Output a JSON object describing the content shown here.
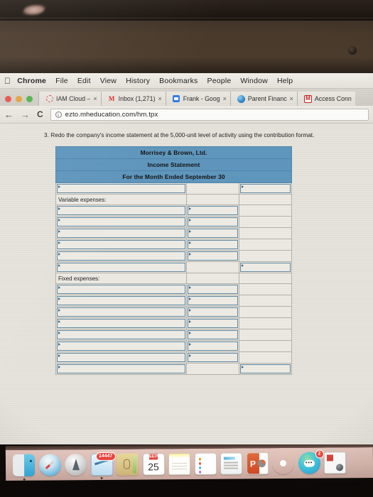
{
  "os_menubar": {
    "apple_icon": "apple-logo-icon",
    "items": [
      {
        "label": "Chrome",
        "bold": true
      },
      {
        "label": "File",
        "bold": false
      },
      {
        "label": "Edit",
        "bold": false
      },
      {
        "label": "View",
        "bold": false
      },
      {
        "label": "History",
        "bold": false
      },
      {
        "label": "Bookmarks",
        "bold": false
      },
      {
        "label": "People",
        "bold": false
      },
      {
        "label": "Window",
        "bold": false
      },
      {
        "label": "Help",
        "bold": false
      }
    ]
  },
  "browser": {
    "window_controls": [
      "close",
      "minimize",
      "maximize"
    ],
    "tabs": [
      {
        "label": "IAM Cloud –",
        "favicon": "dashed-circle-icon",
        "close": "×"
      },
      {
        "label": "Inbox (1,271)",
        "favicon": "gmail-m-icon",
        "close": "×"
      },
      {
        "label": "Frank - Goog",
        "favicon": "blue-square-icon",
        "close": "×"
      },
      {
        "label": "Parent Financ",
        "favicon": "globe-icon",
        "close": "×"
      },
      {
        "label": "Access Conn",
        "favicon": "mcgraw-hill-m-icon",
        "close": "×"
      }
    ],
    "nav": {
      "back": "←",
      "forward": "→",
      "reload": "C"
    },
    "omnibox": {
      "info_glyph": "i",
      "url": "ezto.mheducation.com/hm.tpx"
    }
  },
  "page": {
    "question": "3. Redo the company's income statement at the 5,000-unit level of activity using the contribution format.",
    "worksheet": {
      "header_color": "#5f96bd",
      "title_rows": [
        "Morrisey & Brown, Ltd.",
        "Income Statement",
        "For the Month Ended September 30"
      ],
      "columns": 3,
      "rows": [
        {
          "type": "input-row",
          "label": "",
          "cells": [
            "input",
            "blank",
            "input"
          ]
        },
        {
          "type": "label-row",
          "label": "Variable expenses:",
          "cells": [
            "label",
            "blank",
            "blank"
          ]
        },
        {
          "type": "input-row",
          "label": "",
          "cells": [
            "input",
            "input",
            "blank"
          ]
        },
        {
          "type": "input-row",
          "label": "",
          "cells": [
            "input",
            "input",
            "blank"
          ]
        },
        {
          "type": "input-row",
          "label": "",
          "cells": [
            "input",
            "input",
            "blank"
          ]
        },
        {
          "type": "input-row",
          "label": "",
          "cells": [
            "input",
            "input",
            "blank"
          ]
        },
        {
          "type": "input-row",
          "label": "",
          "cells": [
            "input",
            "input",
            "blank"
          ]
        },
        {
          "type": "input-row",
          "label": "",
          "cells": [
            "input",
            "blank",
            "input"
          ]
        },
        {
          "type": "label-row",
          "label": "Fixed expenses:",
          "cells": [
            "label",
            "blank",
            "blank"
          ]
        },
        {
          "type": "input-row",
          "label": "",
          "cells": [
            "input",
            "input",
            "blank"
          ]
        },
        {
          "type": "input-row",
          "label": "",
          "cells": [
            "input",
            "input",
            "blank"
          ]
        },
        {
          "type": "input-row",
          "label": "",
          "cells": [
            "input",
            "input",
            "blank"
          ]
        },
        {
          "type": "input-row",
          "label": "",
          "cells": [
            "input",
            "input",
            "blank"
          ]
        },
        {
          "type": "input-row",
          "label": "",
          "cells": [
            "input",
            "input",
            "blank"
          ]
        },
        {
          "type": "input-row",
          "label": "",
          "cells": [
            "input",
            "input",
            "blank"
          ]
        },
        {
          "type": "input-row",
          "label": "",
          "cells": [
            "input",
            "input",
            "blank"
          ]
        },
        {
          "type": "input-row",
          "label": "",
          "cells": [
            "input",
            "blank",
            "input"
          ]
        }
      ]
    }
  },
  "dock": {
    "items": [
      {
        "name": "finder",
        "label": "Finder",
        "badge": null,
        "running": true
      },
      {
        "name": "safari",
        "label": "Safari",
        "badge": null,
        "running": false
      },
      {
        "name": "launchpad",
        "label": "Launchpad",
        "badge": null,
        "running": false
      },
      {
        "name": "mail",
        "label": "Mail",
        "badge": "14447",
        "running": true
      },
      {
        "name": "contacts",
        "label": "Contacts",
        "badge": null,
        "running": false
      },
      {
        "name": "calendar",
        "label": "Calendar",
        "badge": null,
        "running": false,
        "month": "SEP",
        "day": "25"
      },
      {
        "name": "notes",
        "label": "Notes",
        "badge": null,
        "running": false
      },
      {
        "name": "reminders",
        "label": "Reminders",
        "badge": null,
        "running": false
      },
      {
        "name": "news",
        "label": "News",
        "badge": null,
        "running": false
      },
      {
        "name": "powerpoint",
        "label": "PowerPoint",
        "badge": null,
        "running": false,
        "glyph": "P"
      },
      {
        "name": "photos",
        "label": "Photos",
        "badge": null,
        "running": false
      },
      {
        "name": "messages",
        "label": "Messages",
        "badge": "2",
        "running": false,
        "glyph": "•••"
      },
      {
        "name": "qr-app",
        "label": "App",
        "badge": null,
        "running": false
      }
    ]
  }
}
